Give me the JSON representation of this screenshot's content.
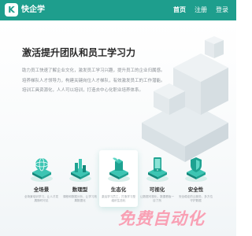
{
  "header": {
    "logo_letter": "K",
    "app_name": "快企学",
    "nav": [
      {
        "label": "首页",
        "active": true
      },
      {
        "label": "注册",
        "active": false
      },
      {
        "label": "登录",
        "active": false
      }
    ]
  },
  "hero": {
    "title": "激活提升团队和员工学习力",
    "description": [
      "助力员工快速了解企业文化，激发员工学习兴趣，提升员工的企业归属感。",
      "培养梯队人才领导力，构建关键岗位人才梯队，有效激发员工的工作潜能。",
      "培训工具资源化，人人可以培训，打造去中心化职业培养体系。"
    ]
  },
  "features": [
    {
      "title": "全场景",
      "desc": "全场景培训学习，让人才发展随时可见",
      "icon": "globe-icon"
    },
    {
      "title": "数理型",
      "desc": "课程和数据分析，让学习效果数据化",
      "icon": "chart-icon"
    },
    {
      "title": "生态化",
      "desc": "激活学习员工，打造学习型组织生态化",
      "icon": "sprout-icon"
    },
    {
      "title": "可视化",
      "desc": "让数据可视化，数据看板一目了然",
      "icon": "mobile-icon"
    },
    {
      "title": "安全性",
      "desc": "安全稳定的云服务，多方位守护数据",
      "icon": "shield-icon"
    }
  ],
  "watermark": "免费自动化",
  "colors": {
    "brand": "#1e9e8d",
    "icon_light": "#3cc5b3",
    "icon_dark": "#13877a",
    "watermark": "#ff5b7e"
  }
}
